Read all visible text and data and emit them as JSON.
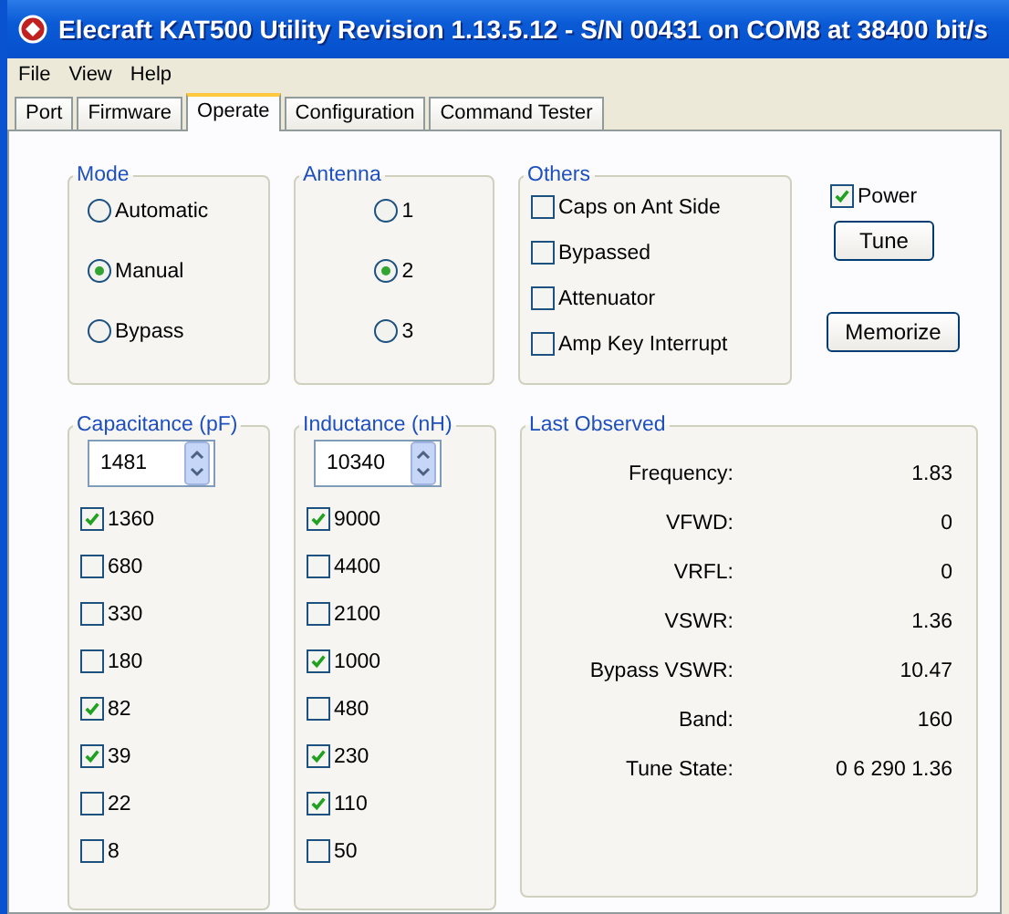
{
  "window": {
    "title": "Elecraft KAT500 Utility Revision 1.13.5.12 - S/N 00431 on COM8 at 38400 bit/s"
  },
  "menu": [
    "File",
    "View",
    "Help"
  ],
  "tabs": [
    {
      "label": "Port",
      "selected": false
    },
    {
      "label": "Firmware",
      "selected": false
    },
    {
      "label": "Operate",
      "selected": true
    },
    {
      "label": "Configuration",
      "selected": false
    },
    {
      "label": "Command Tester",
      "selected": false
    }
  ],
  "mode": {
    "label": "Mode",
    "options": [
      {
        "label": "Automatic",
        "selected": false
      },
      {
        "label": "Manual",
        "selected": true
      },
      {
        "label": "Bypass",
        "selected": false
      }
    ]
  },
  "antenna": {
    "label": "Antenna",
    "options": [
      {
        "label": "1",
        "selected": false
      },
      {
        "label": "2",
        "selected": true
      },
      {
        "label": "3",
        "selected": false
      }
    ]
  },
  "others": {
    "label": "Others",
    "items": [
      {
        "label": "Caps on Ant Side",
        "checked": false
      },
      {
        "label": "Bypassed",
        "checked": false
      },
      {
        "label": "Attenuator",
        "checked": false
      },
      {
        "label": "Amp Key Interrupt",
        "checked": false
      }
    ]
  },
  "power": {
    "label": "Power",
    "checked": true
  },
  "buttons": [
    "Tune",
    "Memorize"
  ],
  "capacitance": {
    "label": "Capacitance (pF)",
    "value": "1481",
    "items": [
      {
        "label": "1360",
        "checked": true
      },
      {
        "label": "680",
        "checked": false
      },
      {
        "label": "330",
        "checked": false
      },
      {
        "label": "180",
        "checked": false
      },
      {
        "label": "82",
        "checked": true
      },
      {
        "label": "39",
        "checked": true
      },
      {
        "label": "22",
        "checked": false
      },
      {
        "label": "8",
        "checked": false
      }
    ]
  },
  "inductance": {
    "label": "Inductance (nH)",
    "value": "10340",
    "items": [
      {
        "label": "9000",
        "checked": true
      },
      {
        "label": "4400",
        "checked": false
      },
      {
        "label": "2100",
        "checked": false
      },
      {
        "label": "1000",
        "checked": true
      },
      {
        "label": "480",
        "checked": false
      },
      {
        "label": "230",
        "checked": true
      },
      {
        "label": "110",
        "checked": true
      },
      {
        "label": "50",
        "checked": false
      }
    ]
  },
  "last_observed": {
    "label": "Last Observed",
    "rows": [
      {
        "label": "Frequency:",
        "value": "1.83"
      },
      {
        "label": "VFWD:",
        "value": "0"
      },
      {
        "label": "VRFL:",
        "value": "0"
      },
      {
        "label": "VSWR:",
        "value": "1.36"
      },
      {
        "label": "Bypass VSWR:",
        "value": "10.47"
      },
      {
        "label": "Band:",
        "value": "160"
      },
      {
        "label": "Tune State:",
        "value": "0 6 290 1.36"
      }
    ]
  }
}
